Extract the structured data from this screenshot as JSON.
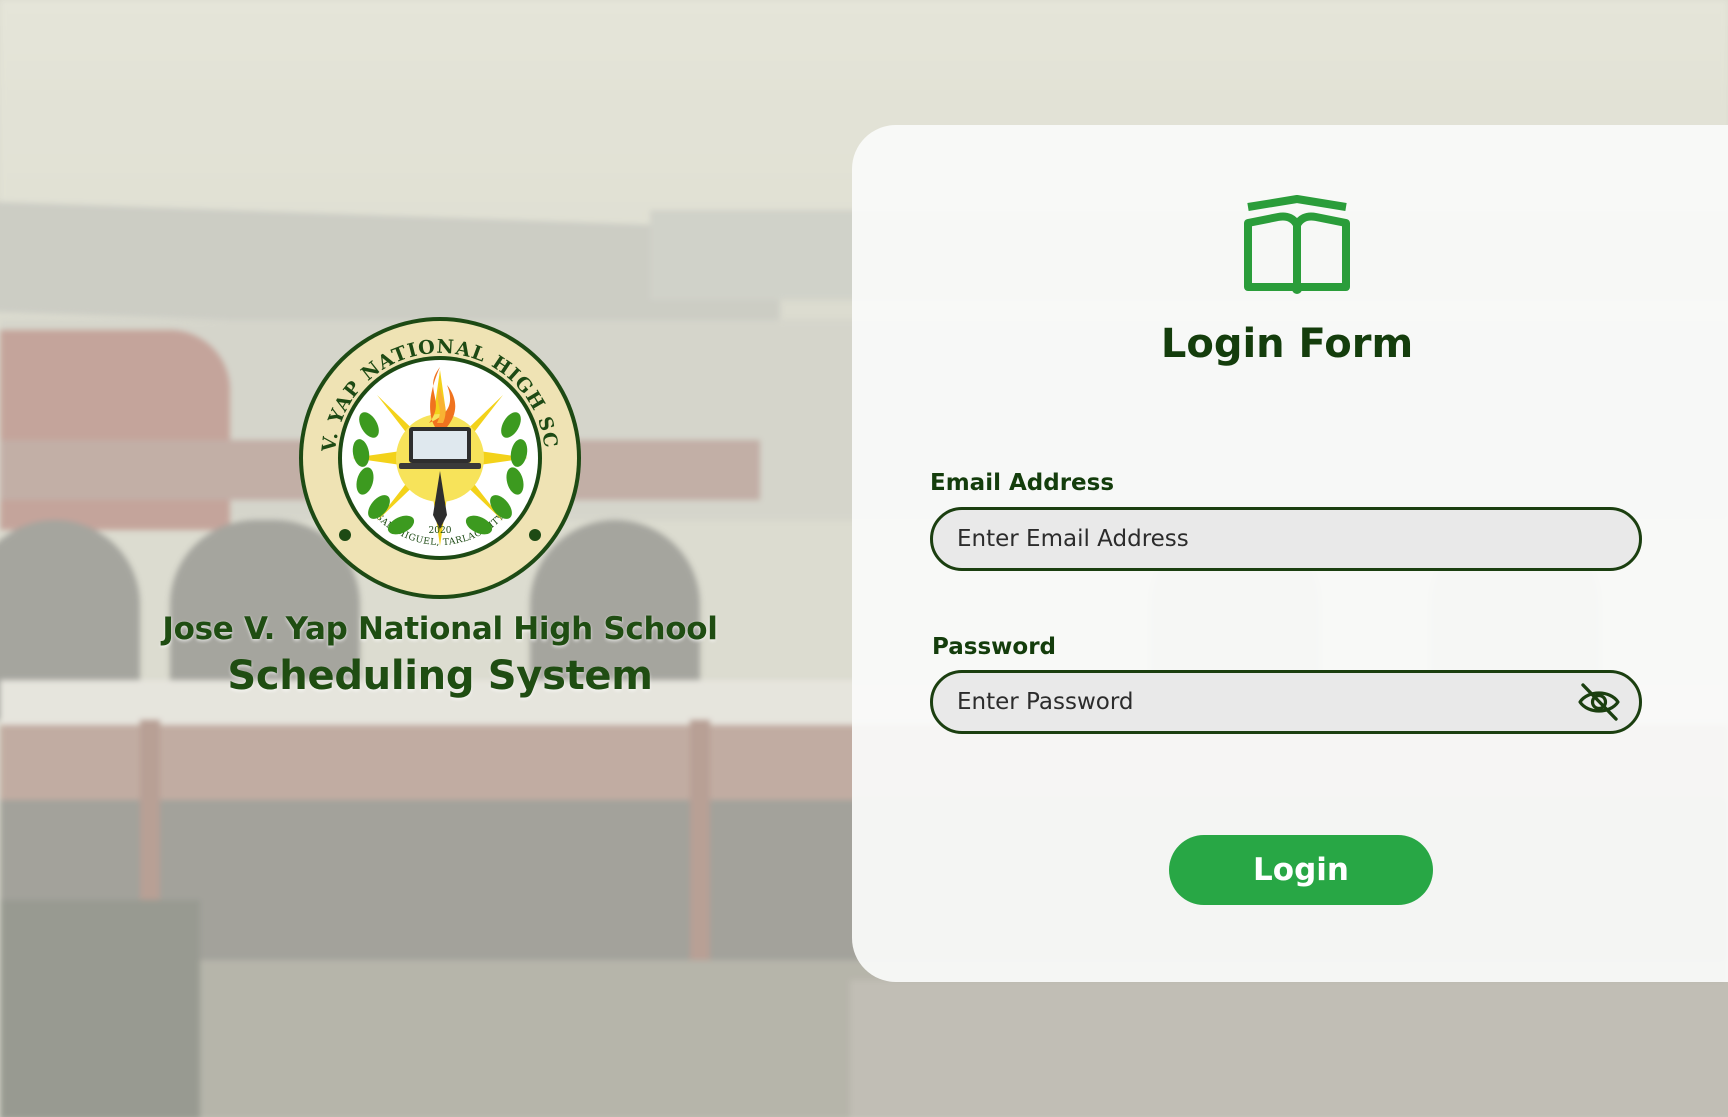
{
  "brand": {
    "seal": {
      "top_text": "JOSE V. YAP NATIONAL HIGH SCHOOL",
      "bottom_text": "SAN MIGUEL, TARLAC CITY",
      "year": "2020"
    },
    "school_name": "Jose V. Yap National High School",
    "system_name": "Scheduling System"
  },
  "login": {
    "icon": "open-book-icon",
    "title": "Login Form",
    "email": {
      "label": "Email Address",
      "placeholder": "Enter Email Address",
      "value": ""
    },
    "password": {
      "label": "Password",
      "placeholder": "Enter Password",
      "value": "",
      "toggle_icon": "eye-slash-icon"
    },
    "submit_label": "Login"
  },
  "colors": {
    "primary_green": "#28a745",
    "dark_green_text": "#143d0c",
    "field_border": "#1b3f10",
    "field_bg": "#e9e9e9",
    "panel_bg": "#fafbfa"
  }
}
